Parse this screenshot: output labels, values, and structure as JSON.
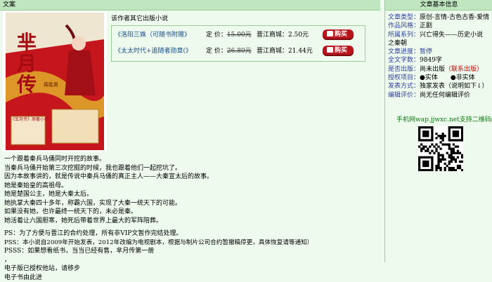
{
  "main": {
    "header": "文案",
    "cover": {
      "title_lines": [
        "芈",
        "月",
        "传"
      ],
      "author": "蒋胜男",
      "footer_text": "《芈月传》原著小说",
      "colors": {
        "top": "#e8ddc8",
        "red": "#c4161c",
        "gold": "#d8a21c"
      }
    },
    "other_works_title": "该作者其它出版小说",
    "publications": [
      {
        "book": "《洛阳三姝（可随书附赠》",
        "price_label": "定 价：",
        "price": "15.00元",
        "mall_label": "晋江商城：",
        "mall_price": "2.50元",
        "buy": "购买"
      },
      {
        "book": "《太太时代+追随者勋章(》",
        "price_label": "定 价：",
        "price": "26.80元",
        "mall_label": "晋江商城：",
        "mall_price": "21.44元",
        "buy": "购买"
      }
    ],
    "intro_lines": [
      "一个跟着秦兵马俑同时开挖的故事。",
      "当秦兵马俑开始第三次挖掘的时候，我也跟着他们一起挖坑了。",
      "因为本故事讲的，就是传说中秦兵马俑的真正主人——大秦宣太后的故事。",
      "她是秦始皇的高祖母。",
      "她是楚国公主，她是大秦太后。",
      "她执掌大秦四十多年，称霸六国，实现了大秦一统天下的可能。",
      "如果没有她，也许最终一统天下的，未必是秦。",
      "她活着让六国胆寒，她死后带着世界上最大的军阵陪葬。",
      "",
      "PS：为了方便与晋江的合约处理，所有非VIP文暂作完结处理。",
      "PSS：本小说自2009年开始发表，2012年改编为电视剧本，根据与制片公司合约暂撤稿停更，具体恢复请等通知）",
      "PSSS：如果想看纸书，当当已经有售，芈月传第一册",
      "，",
      "电子版已授权他站，请移步",
      "电子书由此进"
    ]
  },
  "side": {
    "header": "文章基本信息",
    "info": [
      {
        "label": "文章类型：",
        "value": "原创-言情-古色古香-爱情"
      },
      {
        "label": "作品风格：",
        "value": "正剧"
      },
      {
        "label": "所属系列：",
        "value": "兴亡得失——历史小说"
      },
      {
        "label": "",
        "value": "之秦朝"
      },
      {
        "label": "文章进度：",
        "value": "暂停",
        "link": true
      },
      {
        "label": "全文字数：",
        "value": "9849字"
      },
      {
        "label": "是否出版：",
        "value": "尚未出版",
        "extra": "（联系出版）"
      },
      {
        "label": "授权项目：",
        "value": "●实体　　●非实体"
      },
      {
        "label": "发表方式：",
        "value": "独家发表（说明如下↓）"
      },
      {
        "label": "编辑评价：",
        "value": "尚无任何编辑评价"
      }
    ],
    "mobile_text": "手机网wap.jjwxc.net支持二维码阅读"
  }
}
